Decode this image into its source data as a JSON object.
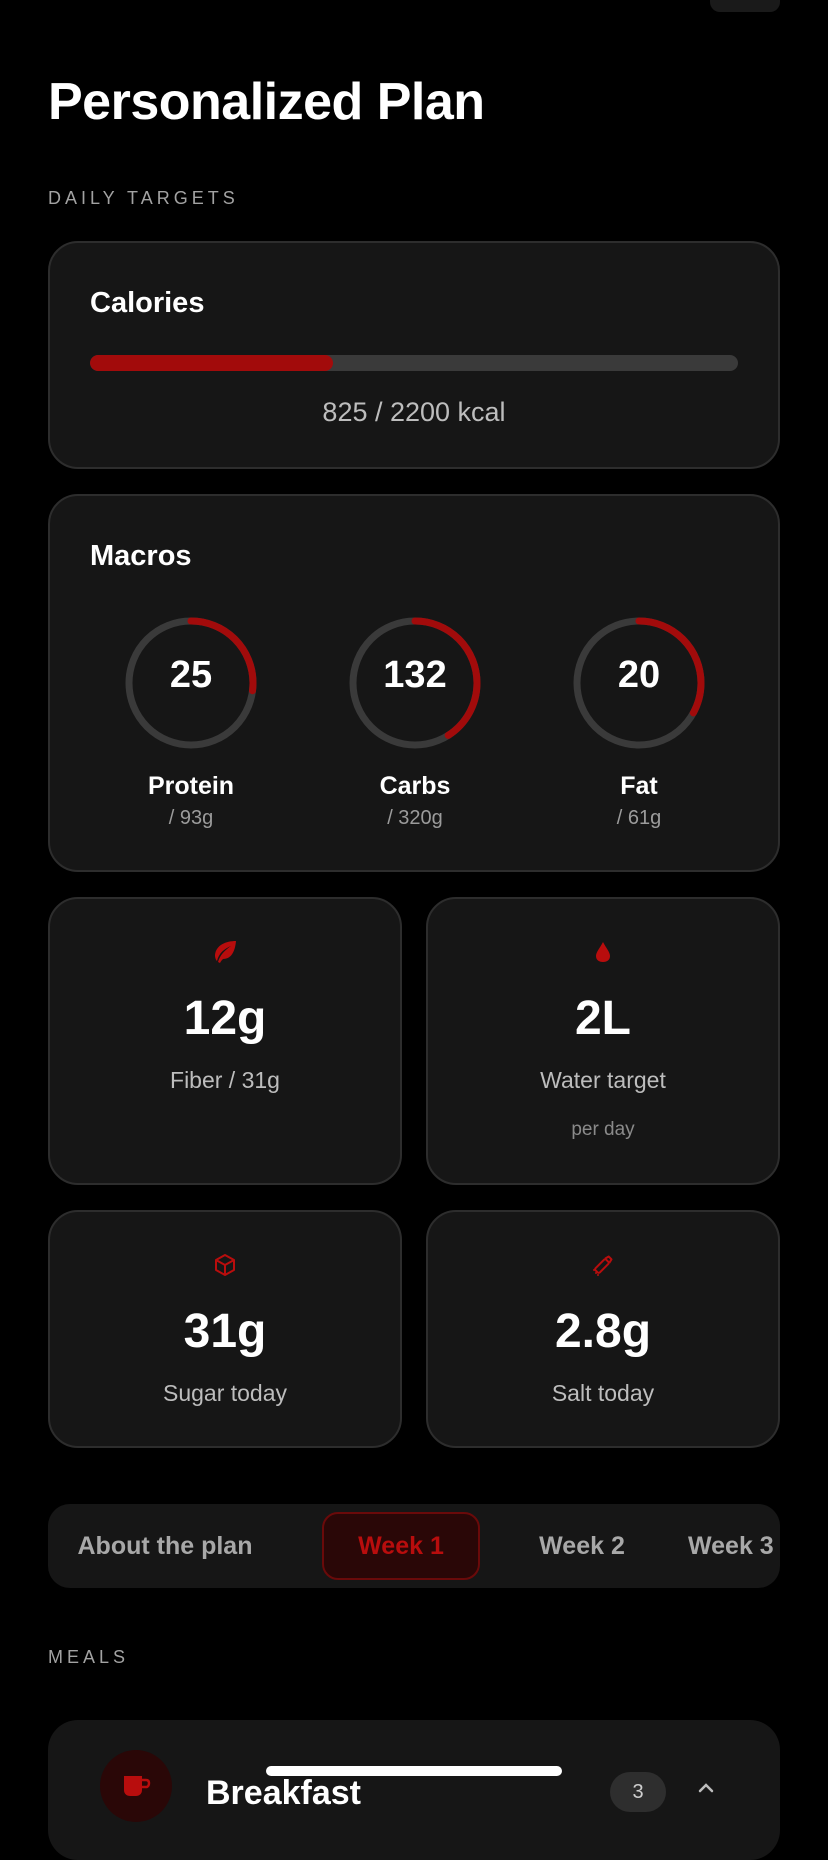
{
  "header": {
    "title": "Personalized Plan"
  },
  "daily_targets": {
    "section_label": "DAILY TARGETS",
    "calories": {
      "title": "Calories",
      "consumed": 825,
      "target": 2200,
      "progress_fraction": 0.375,
      "progress_text": "825 / 2200 kcal"
    },
    "macros": {
      "title": "Macros",
      "items": [
        {
          "value": "25",
          "name": "Protein",
          "target": "/ 93g",
          "progress_fraction": 0.27
        },
        {
          "value": "132",
          "name": "Carbs",
          "target": "/ 320g",
          "progress_fraction": 0.41
        },
        {
          "value": "20",
          "name": "Fat",
          "target": "/ 61g",
          "progress_fraction": 0.33
        }
      ]
    },
    "stats": {
      "fiber": {
        "icon": "leaf-icon",
        "value": "12g",
        "label": "Fiber / 31g"
      },
      "water": {
        "icon": "water-drop-icon",
        "value": "2L",
        "label": "Water target",
        "sublabel": "per day"
      },
      "sugar": {
        "icon": "cube-icon",
        "value": "31g",
        "label": "Sugar today"
      },
      "salt": {
        "icon": "salt-shaker-icon",
        "value": "2.8g",
        "label": "Salt today"
      }
    }
  },
  "tabs": {
    "items": [
      {
        "label": "About the plan",
        "active": false
      },
      {
        "label": "Week 1",
        "active": true
      },
      {
        "label": "Week 2",
        "active": false
      },
      {
        "label": "Week 3",
        "active": false
      }
    ]
  },
  "meals": {
    "section_label": "MEALS",
    "items": [
      {
        "title": "Breakfast",
        "count": "3",
        "icon": "coffee-cup-icon"
      }
    ]
  },
  "colors": {
    "accent": "#a20b0b",
    "background": "#000000",
    "card": "#161616",
    "track": "#3a3a3a"
  }
}
